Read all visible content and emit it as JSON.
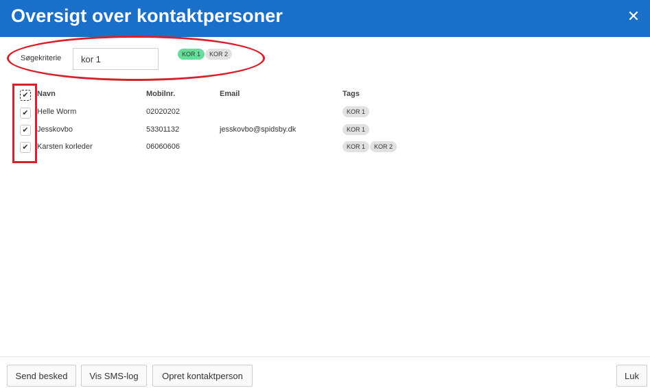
{
  "header": {
    "title": "Oversigt over kontaktpersoner",
    "close_icon": "close-icon"
  },
  "search": {
    "label": "Søgekriterie",
    "value": "kor 1",
    "tags": [
      {
        "label": "KOR 1",
        "active": true
      },
      {
        "label": "KOR 2",
        "active": false
      }
    ]
  },
  "table": {
    "columns": {
      "name": "Navn",
      "mobile": "Mobilnr.",
      "email": "Email",
      "tags": "Tags"
    },
    "all_checked": true,
    "rows": [
      {
        "checked": true,
        "name": "Helle Worm",
        "mobile": "02020202",
        "email": "",
        "tags": [
          "KOR 1"
        ]
      },
      {
        "checked": true,
        "name": "Jesskovbo",
        "mobile": "53301132",
        "email": "jesskovbo@spidsby.dk",
        "tags": [
          "KOR 1"
        ]
      },
      {
        "checked": true,
        "name": "Karsten korleder",
        "mobile": "06060606",
        "email": "",
        "tags": [
          "KOR 1",
          "KOR 2"
        ]
      }
    ]
  },
  "footer": {
    "send_message": "Send besked",
    "sms_log": "Vis SMS-log",
    "create_contact": "Opret kontaktperson",
    "close": "Luk"
  },
  "colors": {
    "header_blue": "#1a6fc9",
    "active_tag_green": "#66dd99",
    "annotation_red": "#d9202a"
  }
}
